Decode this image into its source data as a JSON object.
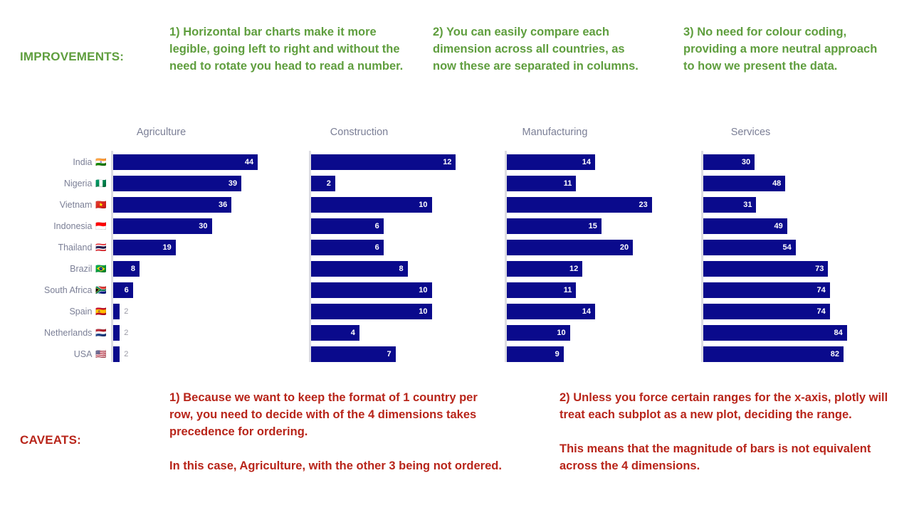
{
  "improvements": {
    "label": "IMPROVEMENTS:",
    "color": "#5f9e3e",
    "notes": [
      "1) Horizontal bar charts make it more legible, going left to right and without the need to rotate you head to read a number.",
      "2) You can easily compare each dimension across all countries, as now these are separated in columns.",
      "3) No need for colour coding, providing a more neutral approach to how we present the data."
    ]
  },
  "caveats": {
    "label": "CAVEATS:",
    "color": "#b8251a",
    "notes": [
      {
        "para1": "1) Because we want to keep the format of 1 country per row, you need to decide with of the 4 dimensions takes precedence for ordering.",
        "para2": "In this case, Agriculture, with the other 3 being not ordered."
      },
      {
        "para1": "2) Unless you force certain ranges for the x-axis, plotly will treat each subplot as a new plot, deciding the range.",
        "para2": "This means that the magnitude of bars is not equivalent across the 4 dimensions."
      }
    ]
  },
  "chart_data": {
    "type": "bar",
    "orientation": "horizontal",
    "title": "",
    "xlabel": "",
    "ylabel": "",
    "grid": false,
    "legend": "none",
    "bar_color": "#0a0a8c",
    "label_color": "#7b7f96",
    "subplot_titles": [
      "Agriculture",
      "Construction",
      "Manufacturing",
      "Services"
    ],
    "categories": [
      "India",
      "Nigeria",
      "Vietnam",
      "Indonesia",
      "Thailand",
      "Brazil",
      "South Africa",
      "Spain",
      "Netherlands",
      "USA"
    ],
    "category_flags": [
      "🇮🇳",
      "🇳🇬",
      "🇻🇳",
      "🇮🇩",
      "🇹🇭",
      "🇧🇷",
      "🇿🇦",
      "🇪🇸",
      "🇳🇱",
      "🇺🇸"
    ],
    "series": [
      {
        "name": "Agriculture",
        "values": [
          44,
          39,
          36,
          30,
          19,
          8,
          6,
          2,
          2,
          2
        ],
        "xlim": [
          0,
          47
        ]
      },
      {
        "name": "Construction",
        "values": [
          12,
          2,
          10,
          6,
          6,
          8,
          10,
          10,
          4,
          7
        ],
        "xlim": [
          0,
          12.8
        ]
      },
      {
        "name": "Manufacturing",
        "values": [
          14,
          11,
          23,
          15,
          20,
          12,
          11,
          14,
          10,
          9
        ],
        "xlim": [
          0,
          24.5
        ]
      },
      {
        "name": "Services",
        "values": [
          30,
          48,
          31,
          49,
          54,
          73,
          74,
          74,
          84,
          82
        ],
        "xlim": [
          0,
          89.5
        ]
      }
    ]
  }
}
